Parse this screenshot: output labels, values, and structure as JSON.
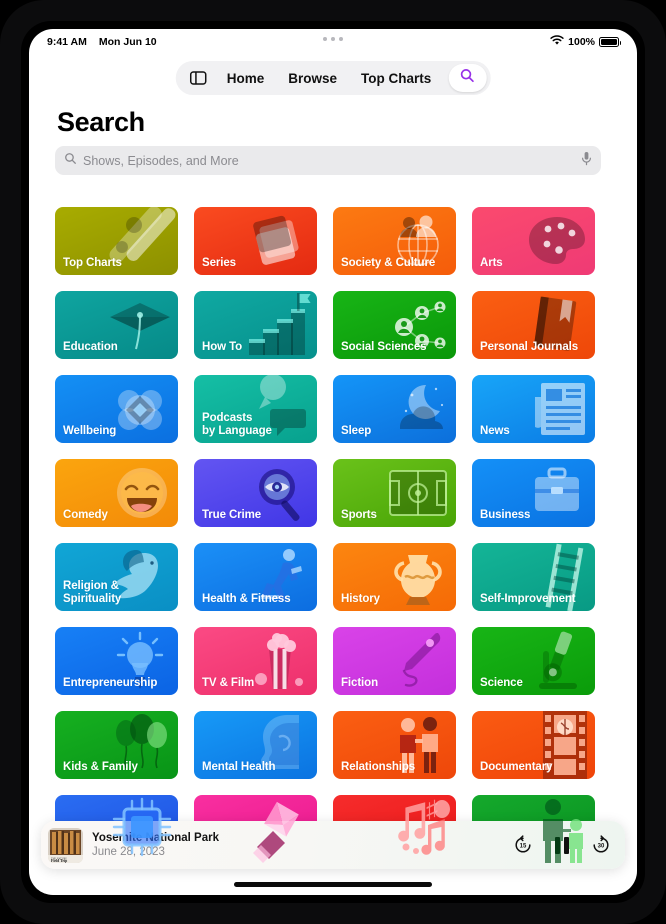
{
  "status_bar": {
    "time": "9:41 AM",
    "date": "Mon Jun 10",
    "battery_percent": "100%",
    "wifi_icon": "wifi-icon",
    "battery_icon": "battery-full-icon"
  },
  "nav": {
    "sidebar_icon": "sidebar-toggle-icon",
    "tabs": [
      {
        "label": "Home"
      },
      {
        "label": "Browse"
      },
      {
        "label": "Top Charts"
      }
    ],
    "search_icon": "search-icon"
  },
  "header": {
    "title": "Search"
  },
  "search": {
    "placeholder": "Shows, Episodes, and More",
    "search_icon": "search-icon",
    "mic_icon": "microphone-icon"
  },
  "categories": [
    {
      "label": "Top Charts",
      "c1": "#a8ac00",
      "c2": "#8d9000",
      "art": "topcharts"
    },
    {
      "label": "Series",
      "c1": "#fa4b20",
      "c2": "#e42a11",
      "art": "series"
    },
    {
      "label": "Society & Culture",
      "c1": "#fc7a12",
      "c2": "#f55c0a",
      "art": "society"
    },
    {
      "label": "Arts",
      "c1": "#fb4a6e",
      "c2": "#ef3a75",
      "art": "arts"
    },
    {
      "label": "Education",
      "c1": "#0fa5a0",
      "c2": "#068a88",
      "art": "education"
    },
    {
      "label": "How To",
      "c1": "#10a9a2",
      "c2": "#06908c",
      "art": "howto"
    },
    {
      "label": "Social Sciences",
      "c1": "#18b516",
      "c2": "#0a9709",
      "art": "socialsci"
    },
    {
      "label": "Personal Journals",
      "c1": "#fb5f12",
      "c2": "#ee4709",
      "art": "journals"
    },
    {
      "label": "Wellbeing",
      "c1": "#1490f5",
      "c2": "#0b6fe0",
      "art": "wellbeing"
    },
    {
      "label": "Podcasts\nby Language",
      "c1": "#15bfa5",
      "c2": "#07a18e",
      "art": "language"
    },
    {
      "label": "Sleep",
      "c1": "#1495f8",
      "c2": "#0c6fdb",
      "art": "sleep"
    },
    {
      "label": "News",
      "c1": "#18a5f8",
      "c2": "#0b7ce5",
      "art": "news"
    },
    {
      "label": "Comedy",
      "c1": "#fba50e",
      "c2": "#f38a08",
      "art": "comedy"
    },
    {
      "label": "True Crime",
      "c1": "#6355f2",
      "c2": "#4036e6",
      "art": "truecrime"
    },
    {
      "label": "Sports",
      "c1": "#6ac21a",
      "c2": "#49a406",
      "art": "sports"
    },
    {
      "label": "Business",
      "c1": "#1490f7",
      "c2": "#0a72e2",
      "art": "business"
    },
    {
      "label": "Religion &\nSpirituality",
      "c1": "#11a6d6",
      "c2": "#0a8fc4",
      "art": "religion"
    },
    {
      "label": "Health & Fitness",
      "c1": "#1b90f7",
      "c2": "#0c6de0",
      "art": "health"
    },
    {
      "label": "History",
      "c1": "#fc8610",
      "c2": "#f56a06",
      "art": "history"
    },
    {
      "label": "Self-Improvement",
      "c1": "#14b597",
      "c2": "#089a84",
      "art": "selfimp"
    },
    {
      "label": "Entrepreneurship",
      "c1": "#1780f6",
      "c2": "#0b63e4",
      "art": "entrepreneur"
    },
    {
      "label": "TV & Film",
      "c1": "#fb4a84",
      "c2": "#ed2f6b",
      "art": "tvfilm"
    },
    {
      "label": "Fiction",
      "c1": "#d943e8",
      "c2": "#c42fdc",
      "art": "fiction"
    },
    {
      "label": "Science",
      "c1": "#18b516",
      "c2": "#0a9c0a",
      "art": "science"
    },
    {
      "label": "Kids & Family",
      "c1": "#16b020",
      "c2": "#089417",
      "art": "kids"
    },
    {
      "label": "Mental Health",
      "c1": "#179af7",
      "c2": "#0b73e1",
      "art": "mental"
    },
    {
      "label": "Relationships",
      "c1": "#fb5f12",
      "c2": "#ee470a",
      "art": "relationships"
    },
    {
      "label": "Documentary",
      "c1": "#fb5b12",
      "c2": "#ef4409",
      "art": "documentary"
    },
    {
      "label": "",
      "c1": "#2a6df2",
      "c2": "#1d4fe0",
      "art": "technology"
    },
    {
      "label": "",
      "c1": "#f92fa0",
      "c2": "#e8178c",
      "art": "design"
    },
    {
      "label": "",
      "c1": "#f62c2c",
      "c2": "#e81717",
      "art": "music"
    },
    {
      "label": "",
      "c1": "#15a92c",
      "c2": "#089020",
      "art": "parenting"
    }
  ],
  "now_playing": {
    "artwork_caption": "Field Trip",
    "title": "Yosemite National Park",
    "date": "June 28, 2023",
    "skip_back_label": "15",
    "skip_forward_label": "30",
    "skip_back_icon": "skip-back-15-icon",
    "pause_icon": "pause-icon",
    "skip_forward_icon": "skip-forward-30-icon"
  }
}
